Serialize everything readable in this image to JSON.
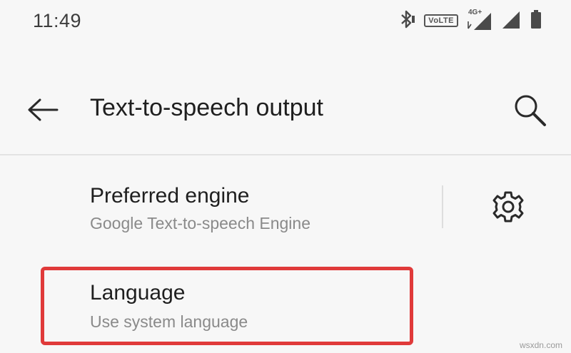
{
  "status_bar": {
    "time": "11:49",
    "volte_label": "VoLTE",
    "network_label": "4G+",
    "icons": [
      "bluetooth-icon",
      "volte-icon",
      "signal-4g-icon",
      "signal-icon",
      "battery-icon"
    ]
  },
  "app_bar": {
    "title": "Text-to-speech output",
    "back_icon": "arrow-back-icon",
    "search_icon": "search-icon"
  },
  "settings": {
    "preferred_engine": {
      "title": "Preferred engine",
      "summary": "Google Text-to-speech Engine",
      "action_icon": "gear-icon"
    },
    "language": {
      "title": "Language",
      "summary": "Use system language"
    }
  },
  "annotation": {
    "color": "#e03a3a"
  },
  "watermark": "wsxdn.com"
}
